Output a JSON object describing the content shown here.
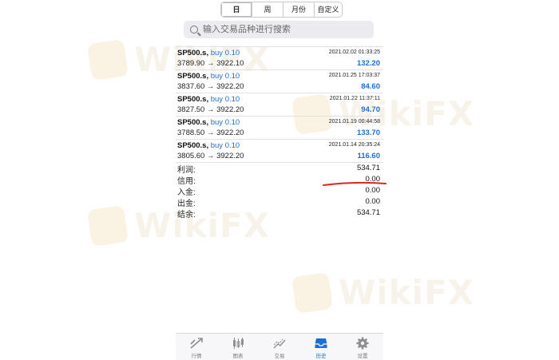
{
  "segments": [
    {
      "label": "日",
      "active": true
    },
    {
      "label": "周",
      "active": false
    },
    {
      "label": "月份",
      "active": false
    },
    {
      "label": "自定义",
      "active": false
    }
  ],
  "search": {
    "placeholder": "输入交易品种进行搜索"
  },
  "deals": [
    {
      "symbol": "SP500.s,",
      "side": "buy 0.10",
      "prices": "3789.90 → 3922.10",
      "time": "2021.02.02 01:33:25",
      "profit": "132.20"
    },
    {
      "symbol": "SP500.s,",
      "side": "buy 0.10",
      "prices": "3837.60 → 3922.20",
      "time": "2021.01.25 17:03:37",
      "profit": "84.60"
    },
    {
      "symbol": "SP500.s,",
      "side": "buy 0.10",
      "prices": "3827.50 → 3922.20",
      "time": "2021.01.22 11:37:11",
      "profit": "94.70"
    },
    {
      "symbol": "SP500.s,",
      "side": "buy 0.10",
      "prices": "3788.50 → 3922.20",
      "time": "2021.01.19 00:44:58",
      "profit": "133.70"
    },
    {
      "symbol": "SP500.s,",
      "side": "buy 0.10",
      "prices": "3805.60 → 3922.20",
      "time": "2021.01.14 20:35:24",
      "profit": "116.60"
    }
  ],
  "summary": [
    {
      "label": "利润:",
      "value": "534.71"
    },
    {
      "label": "信用:",
      "value": "0.00"
    },
    {
      "label": "入金:",
      "value": "0.00"
    },
    {
      "label": "出金:",
      "value": "0.00"
    },
    {
      "label": "结余:",
      "value": "534.71"
    }
  ],
  "tabs": [
    {
      "label": "行情",
      "icon": "quotes-icon",
      "active": false
    },
    {
      "label": "图表",
      "icon": "chart-icon",
      "active": false
    },
    {
      "label": "交易",
      "icon": "trade-icon",
      "active": false
    },
    {
      "label": "历史",
      "icon": "history-icon",
      "active": true
    },
    {
      "label": "设置",
      "icon": "settings-icon",
      "active": false
    }
  ],
  "watermark": {
    "text": "WikiFX"
  },
  "colors": {
    "accent": "#1a6fd0",
    "annotation": "#d8281e"
  }
}
